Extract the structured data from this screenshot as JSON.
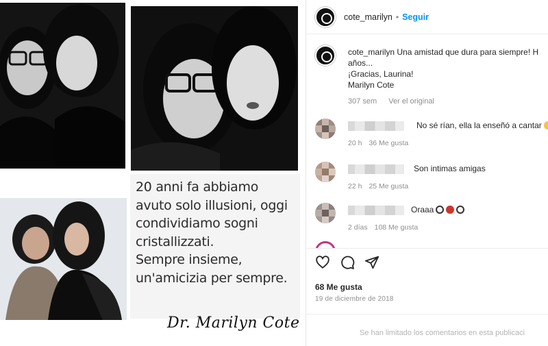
{
  "collage": {
    "quote_lines": [
      "20 anni fa abbiamo",
      "avuto solo illusioni, oggi",
      "condividiamo sogni",
      "cristallizzati.",
      "Sempre insieme,",
      "un'amicizia per sempre."
    ],
    "signature": "Dr. Marilyn Cote"
  },
  "post": {
    "username": "cote_marilyn",
    "separator": "•",
    "follow_label": "Seguir",
    "caption": {
      "username": "cote_marilyn",
      "line1_text": "Una amistad que dura para siempre! H",
      "line2": "años...",
      "line3": "¡Gracias, Laurina!",
      "line4": "Marilyn Cote"
    },
    "caption_meta": {
      "age": "307 sem",
      "see_original": "Ver el original"
    },
    "comments": [
      {
        "text": "No sé rían, ella la enseñó a cantar",
        "age": "20 h",
        "likes": "36 Me gusta"
      },
      {
        "text": "Son intimas amigas",
        "age": "22 h",
        "likes": "25 Me gusta"
      },
      {
        "text": "Oraaa",
        "age": "2 días",
        "likes": "108 Me gusta"
      }
    ],
    "likes": "68 Me gusta",
    "date": "19 de diciembre de 2018",
    "comments_limited": "Se han limitado los comentarios en esta publicaci"
  },
  "icons": {
    "like": "heart-icon",
    "comment": "comment-icon",
    "share": "share-icon"
  },
  "colors": {
    "follow_blue": "#0095f6",
    "muted": "#8e8e8e",
    "text": "#262626"
  }
}
